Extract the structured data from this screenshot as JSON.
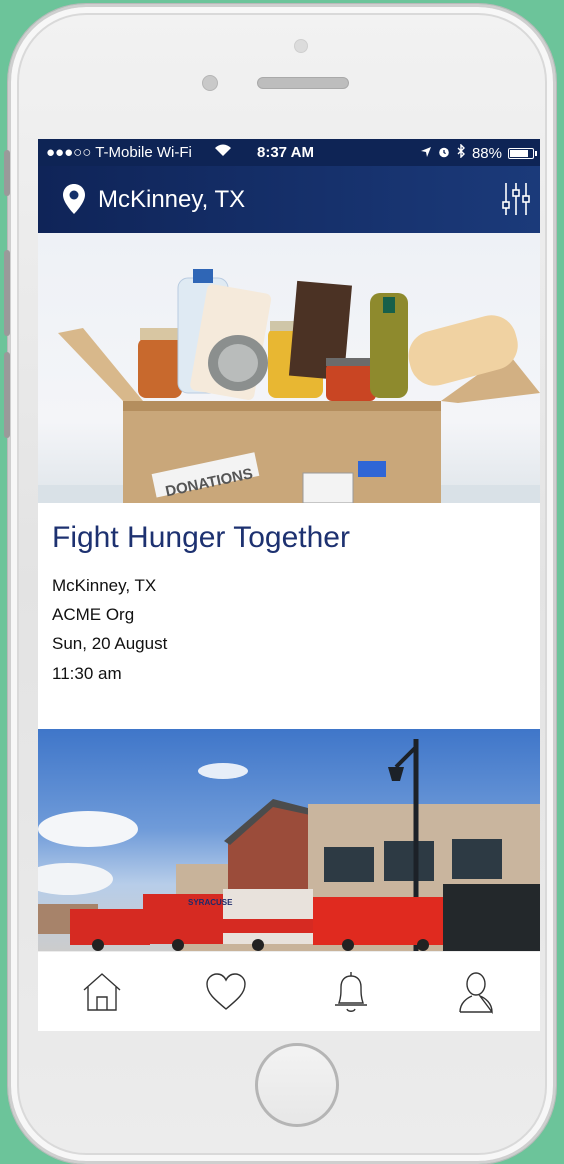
{
  "status_bar": {
    "carrier": "●●●○○ T-Mobile Wi-Fi",
    "time": "8:37 AM",
    "battery": "88%",
    "battery_fraction": 0.88
  },
  "header": {
    "location": "McKinney, TX",
    "left_icon": "location-pin-icon",
    "right_icon": "filter-sliders-icon"
  },
  "events": [
    {
      "image_label": "DONATIONS",
      "title": "Fight Hunger Together",
      "city": "McKinney, TX",
      "organization": "ACME Org",
      "date": "Sun, 20 August",
      "time": "11:30 am"
    },
    {
      "image_label": "SYRACUSE"
    }
  ],
  "tab_bar": [
    "home-icon",
    "heart-icon",
    "bell-icon",
    "profile-icon"
  ],
  "colors": {
    "navy": "#0e2455",
    "title_blue": "#1d3170",
    "background": "#6cc49a"
  }
}
